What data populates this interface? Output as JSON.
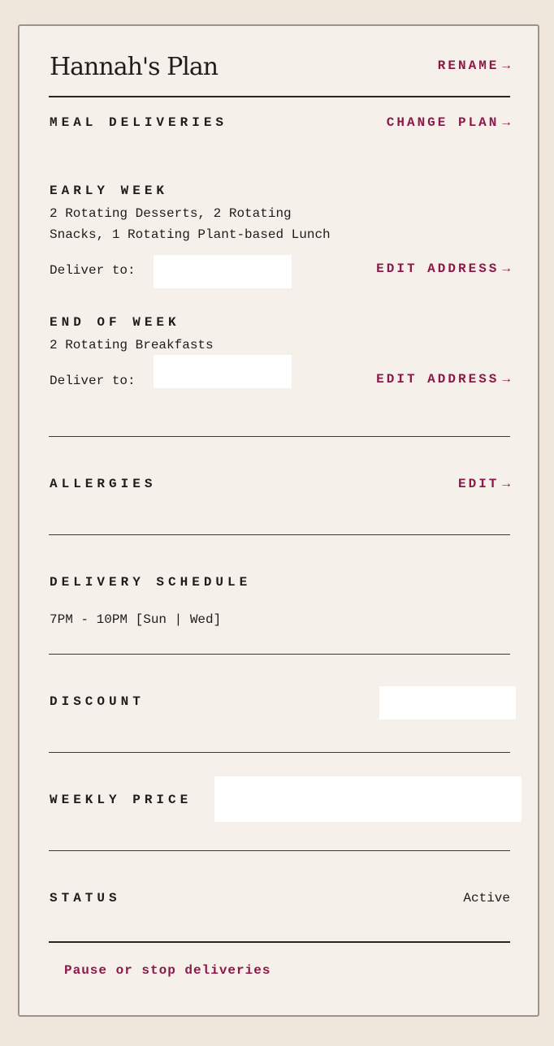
{
  "plan": {
    "title": "Hannah's Plan",
    "rename_label": "RENAME",
    "arrow": "→"
  },
  "meal_deliveries": {
    "heading": "MEAL DELIVERIES",
    "change_plan_label": "CHANGE PLAN",
    "groups": [
      {
        "heading": "EARLY WEEK",
        "items_line1": "2 Rotating Desserts, 2 Rotating",
        "items_line2": "Snacks, 1 Rotating Plant-based Lunch",
        "deliver_to_label": "Deliver to:",
        "edit_address_label": "EDIT ADDRESS"
      },
      {
        "heading": "END OF WEEK",
        "items_line1": "2 Rotating Breakfasts",
        "deliver_to_label": "Deliver to:",
        "edit_address_label": "EDIT ADDRESS"
      }
    ]
  },
  "allergies": {
    "heading": "ALLERGIES",
    "edit_label": "EDIT"
  },
  "delivery_schedule": {
    "heading": "DELIVERY SCHEDULE",
    "value": "7PM - 10PM [Sun | Wed]"
  },
  "discount": {
    "heading": "DISCOUNT"
  },
  "weekly_price": {
    "heading": "WEEKLY PRICE"
  },
  "status": {
    "heading": "STATUS",
    "value": "Active"
  },
  "footer": {
    "pause_label": "Pause or stop deliveries"
  },
  "colors": {
    "background": "#f0e7dc",
    "card": "#f5f0ea",
    "accent": "#8b1a4a",
    "text": "#1f1d1b"
  }
}
